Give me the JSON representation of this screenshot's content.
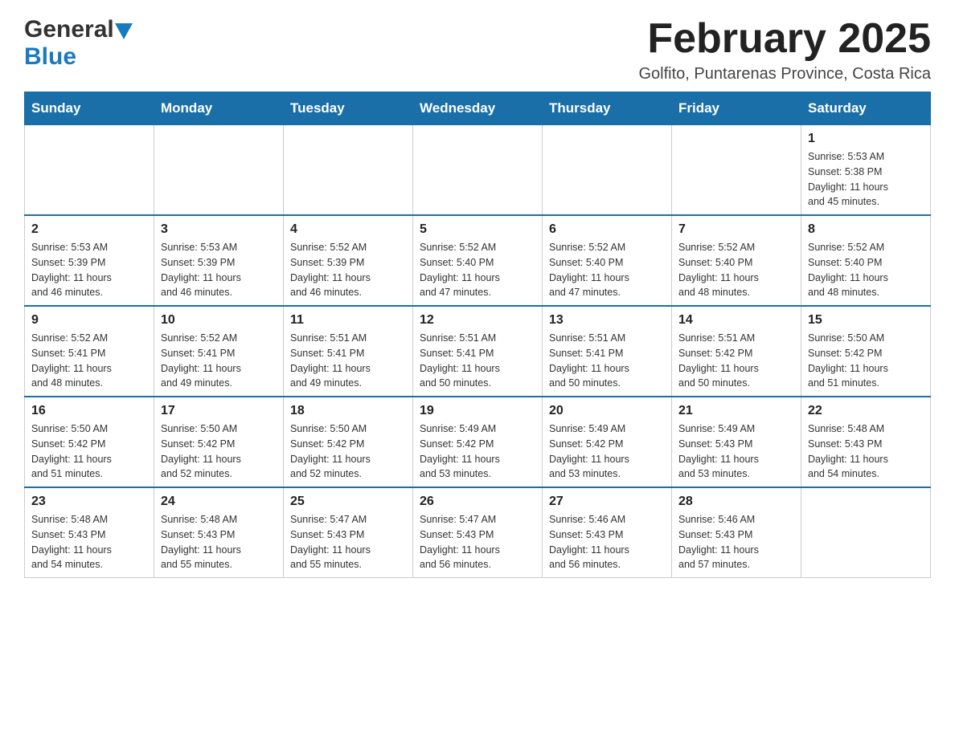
{
  "header": {
    "logo": {
      "general": "General",
      "blue": "Blue",
      "triangle_color": "#1a7abf"
    },
    "title": "February 2025",
    "location": "Golfito, Puntarenas Province, Costa Rica"
  },
  "calendar": {
    "headers": [
      "Sunday",
      "Monday",
      "Tuesday",
      "Wednesday",
      "Thursday",
      "Friday",
      "Saturday"
    ],
    "accent_color": "#1a6fa8",
    "weeks": [
      {
        "days": [
          {
            "num": "",
            "info": ""
          },
          {
            "num": "",
            "info": ""
          },
          {
            "num": "",
            "info": ""
          },
          {
            "num": "",
            "info": ""
          },
          {
            "num": "",
            "info": ""
          },
          {
            "num": "",
            "info": ""
          },
          {
            "num": "1",
            "info": "Sunrise: 5:53 AM\nSunset: 5:38 PM\nDaylight: 11 hours\nand 45 minutes."
          }
        ]
      },
      {
        "days": [
          {
            "num": "2",
            "info": "Sunrise: 5:53 AM\nSunset: 5:39 PM\nDaylight: 11 hours\nand 46 minutes."
          },
          {
            "num": "3",
            "info": "Sunrise: 5:53 AM\nSunset: 5:39 PM\nDaylight: 11 hours\nand 46 minutes."
          },
          {
            "num": "4",
            "info": "Sunrise: 5:52 AM\nSunset: 5:39 PM\nDaylight: 11 hours\nand 46 minutes."
          },
          {
            "num": "5",
            "info": "Sunrise: 5:52 AM\nSunset: 5:40 PM\nDaylight: 11 hours\nand 47 minutes."
          },
          {
            "num": "6",
            "info": "Sunrise: 5:52 AM\nSunset: 5:40 PM\nDaylight: 11 hours\nand 47 minutes."
          },
          {
            "num": "7",
            "info": "Sunrise: 5:52 AM\nSunset: 5:40 PM\nDaylight: 11 hours\nand 48 minutes."
          },
          {
            "num": "8",
            "info": "Sunrise: 5:52 AM\nSunset: 5:40 PM\nDaylight: 11 hours\nand 48 minutes."
          }
        ]
      },
      {
        "days": [
          {
            "num": "9",
            "info": "Sunrise: 5:52 AM\nSunset: 5:41 PM\nDaylight: 11 hours\nand 48 minutes."
          },
          {
            "num": "10",
            "info": "Sunrise: 5:52 AM\nSunset: 5:41 PM\nDaylight: 11 hours\nand 49 minutes."
          },
          {
            "num": "11",
            "info": "Sunrise: 5:51 AM\nSunset: 5:41 PM\nDaylight: 11 hours\nand 49 minutes."
          },
          {
            "num": "12",
            "info": "Sunrise: 5:51 AM\nSunset: 5:41 PM\nDaylight: 11 hours\nand 50 minutes."
          },
          {
            "num": "13",
            "info": "Sunrise: 5:51 AM\nSunset: 5:41 PM\nDaylight: 11 hours\nand 50 minutes."
          },
          {
            "num": "14",
            "info": "Sunrise: 5:51 AM\nSunset: 5:42 PM\nDaylight: 11 hours\nand 50 minutes."
          },
          {
            "num": "15",
            "info": "Sunrise: 5:50 AM\nSunset: 5:42 PM\nDaylight: 11 hours\nand 51 minutes."
          }
        ]
      },
      {
        "days": [
          {
            "num": "16",
            "info": "Sunrise: 5:50 AM\nSunset: 5:42 PM\nDaylight: 11 hours\nand 51 minutes."
          },
          {
            "num": "17",
            "info": "Sunrise: 5:50 AM\nSunset: 5:42 PM\nDaylight: 11 hours\nand 52 minutes."
          },
          {
            "num": "18",
            "info": "Sunrise: 5:50 AM\nSunset: 5:42 PM\nDaylight: 11 hours\nand 52 minutes."
          },
          {
            "num": "19",
            "info": "Sunrise: 5:49 AM\nSunset: 5:42 PM\nDaylight: 11 hours\nand 53 minutes."
          },
          {
            "num": "20",
            "info": "Sunrise: 5:49 AM\nSunset: 5:42 PM\nDaylight: 11 hours\nand 53 minutes."
          },
          {
            "num": "21",
            "info": "Sunrise: 5:49 AM\nSunset: 5:43 PM\nDaylight: 11 hours\nand 53 minutes."
          },
          {
            "num": "22",
            "info": "Sunrise: 5:48 AM\nSunset: 5:43 PM\nDaylight: 11 hours\nand 54 minutes."
          }
        ]
      },
      {
        "days": [
          {
            "num": "23",
            "info": "Sunrise: 5:48 AM\nSunset: 5:43 PM\nDaylight: 11 hours\nand 54 minutes."
          },
          {
            "num": "24",
            "info": "Sunrise: 5:48 AM\nSunset: 5:43 PM\nDaylight: 11 hours\nand 55 minutes."
          },
          {
            "num": "25",
            "info": "Sunrise: 5:47 AM\nSunset: 5:43 PM\nDaylight: 11 hours\nand 55 minutes."
          },
          {
            "num": "26",
            "info": "Sunrise: 5:47 AM\nSunset: 5:43 PM\nDaylight: 11 hours\nand 56 minutes."
          },
          {
            "num": "27",
            "info": "Sunrise: 5:46 AM\nSunset: 5:43 PM\nDaylight: 11 hours\nand 56 minutes."
          },
          {
            "num": "28",
            "info": "Sunrise: 5:46 AM\nSunset: 5:43 PM\nDaylight: 11 hours\nand 57 minutes."
          },
          {
            "num": "",
            "info": ""
          }
        ]
      }
    ]
  }
}
